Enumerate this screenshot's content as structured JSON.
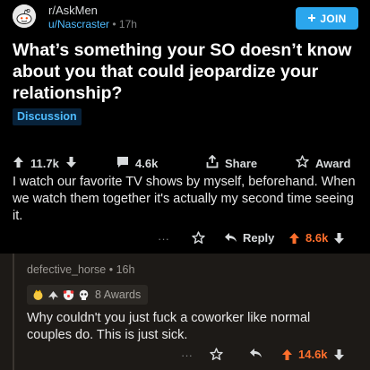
{
  "post": {
    "subreddit": "r/AskMen",
    "author": "u/Nascraster",
    "age": "17h",
    "join_label": "JOIN",
    "title": "What’s something your SO doesn’t know about you that could jeopardize your relationship?",
    "flair": "Discussion",
    "upvotes": "11.7k",
    "comments": "4.6k",
    "share_label": "Share",
    "award_label": "Award"
  },
  "op_comment": {
    "text": "I watch our favorite TV shows by myself, beforehand. When we watch them together it's actually my second time seeing it.",
    "more": "···",
    "reply_label": "Reply",
    "score": "8.6k"
  },
  "reply_comment": {
    "author": "defective_horse",
    "age": "16h",
    "awards_label": "8 Awards",
    "text": "Why couldn't you just fuck a coworker like normal couples do. This is just sick.",
    "more": "···",
    "score": "14.6k"
  },
  "colors": {
    "accent": "#2ba6ed",
    "link": "#4fbcff",
    "upvote": "#ff6f2c",
    "background": "#000000",
    "comment_bg": "#1d1a17"
  }
}
